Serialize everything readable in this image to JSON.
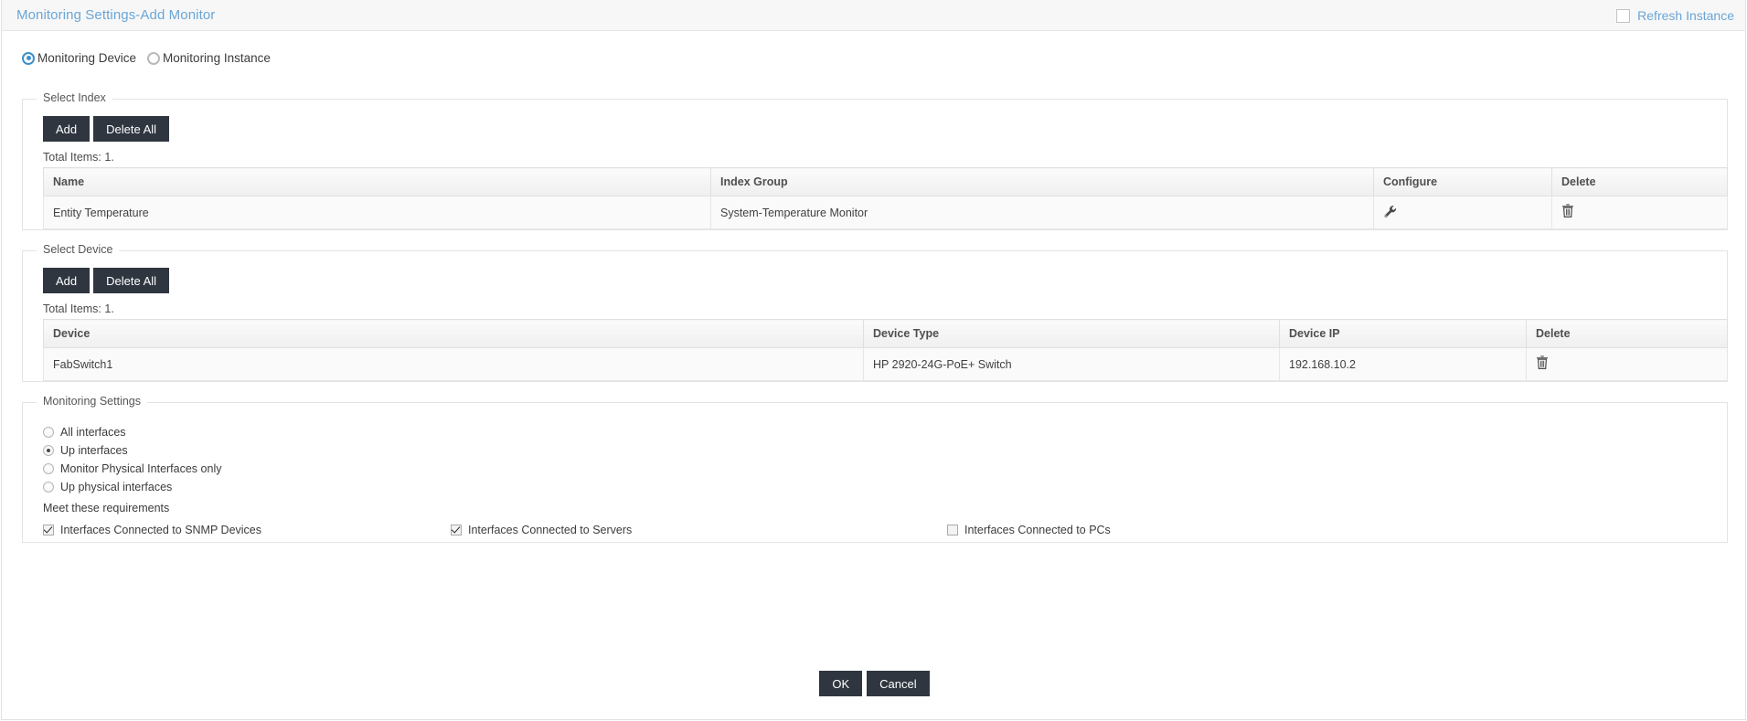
{
  "titlebar": {
    "title": "Monitoring Settings-Add Monitor",
    "refresh_label": "Refresh Instance",
    "refresh_checked": false
  },
  "mode_radios": [
    {
      "label": "Monitoring Device",
      "checked": true
    },
    {
      "label": "Monitoring Instance",
      "checked": false
    }
  ],
  "select_index": {
    "legend": "Select Index",
    "add_label": "Add",
    "delete_all_label": "Delete All",
    "total_items": "Total Items: 1.",
    "columns": [
      "Name",
      "Index Group",
      "Configure",
      "Delete"
    ],
    "rows": [
      {
        "name": "Entity Temperature",
        "index_group": "System-Temperature Monitor",
        "configure_icon": "wrench-icon",
        "delete_icon": "trash-icon"
      }
    ]
  },
  "select_device": {
    "legend": "Select Device",
    "add_label": "Add",
    "delete_all_label": "Delete All",
    "total_items": "Total Items: 1.",
    "columns": [
      "Device",
      "Device Type",
      "Device IP",
      "Delete"
    ],
    "rows": [
      {
        "device": "FabSwitch1",
        "device_type": "HP 2920-24G-PoE+ Switch",
        "device_ip": "192.168.10.2",
        "delete_icon": "trash-icon"
      }
    ]
  },
  "monitoring_settings": {
    "legend": "Monitoring Settings",
    "interface_options": [
      {
        "label": "All interfaces",
        "checked": false
      },
      {
        "label": "Up interfaces",
        "checked": true
      },
      {
        "label": "Monitor Physical Interfaces only",
        "checked": false
      },
      {
        "label": "Up physical interfaces",
        "checked": false
      }
    ],
    "requirements_label": "Meet these requirements",
    "requirements": [
      {
        "label": "Interfaces Connected to SNMP Devices",
        "checked": true
      },
      {
        "label": "Interfaces Connected to Servers",
        "checked": true
      },
      {
        "label": "Interfaces Connected to PCs",
        "checked": false
      }
    ]
  },
  "footer": {
    "ok_label": "OK",
    "cancel_label": "Cancel"
  },
  "colors": {
    "title_blue": "#6aa6d6",
    "button_dark": "#2f3640",
    "radio_accent": "#3d8fcc",
    "border": "#e3e3e3"
  }
}
